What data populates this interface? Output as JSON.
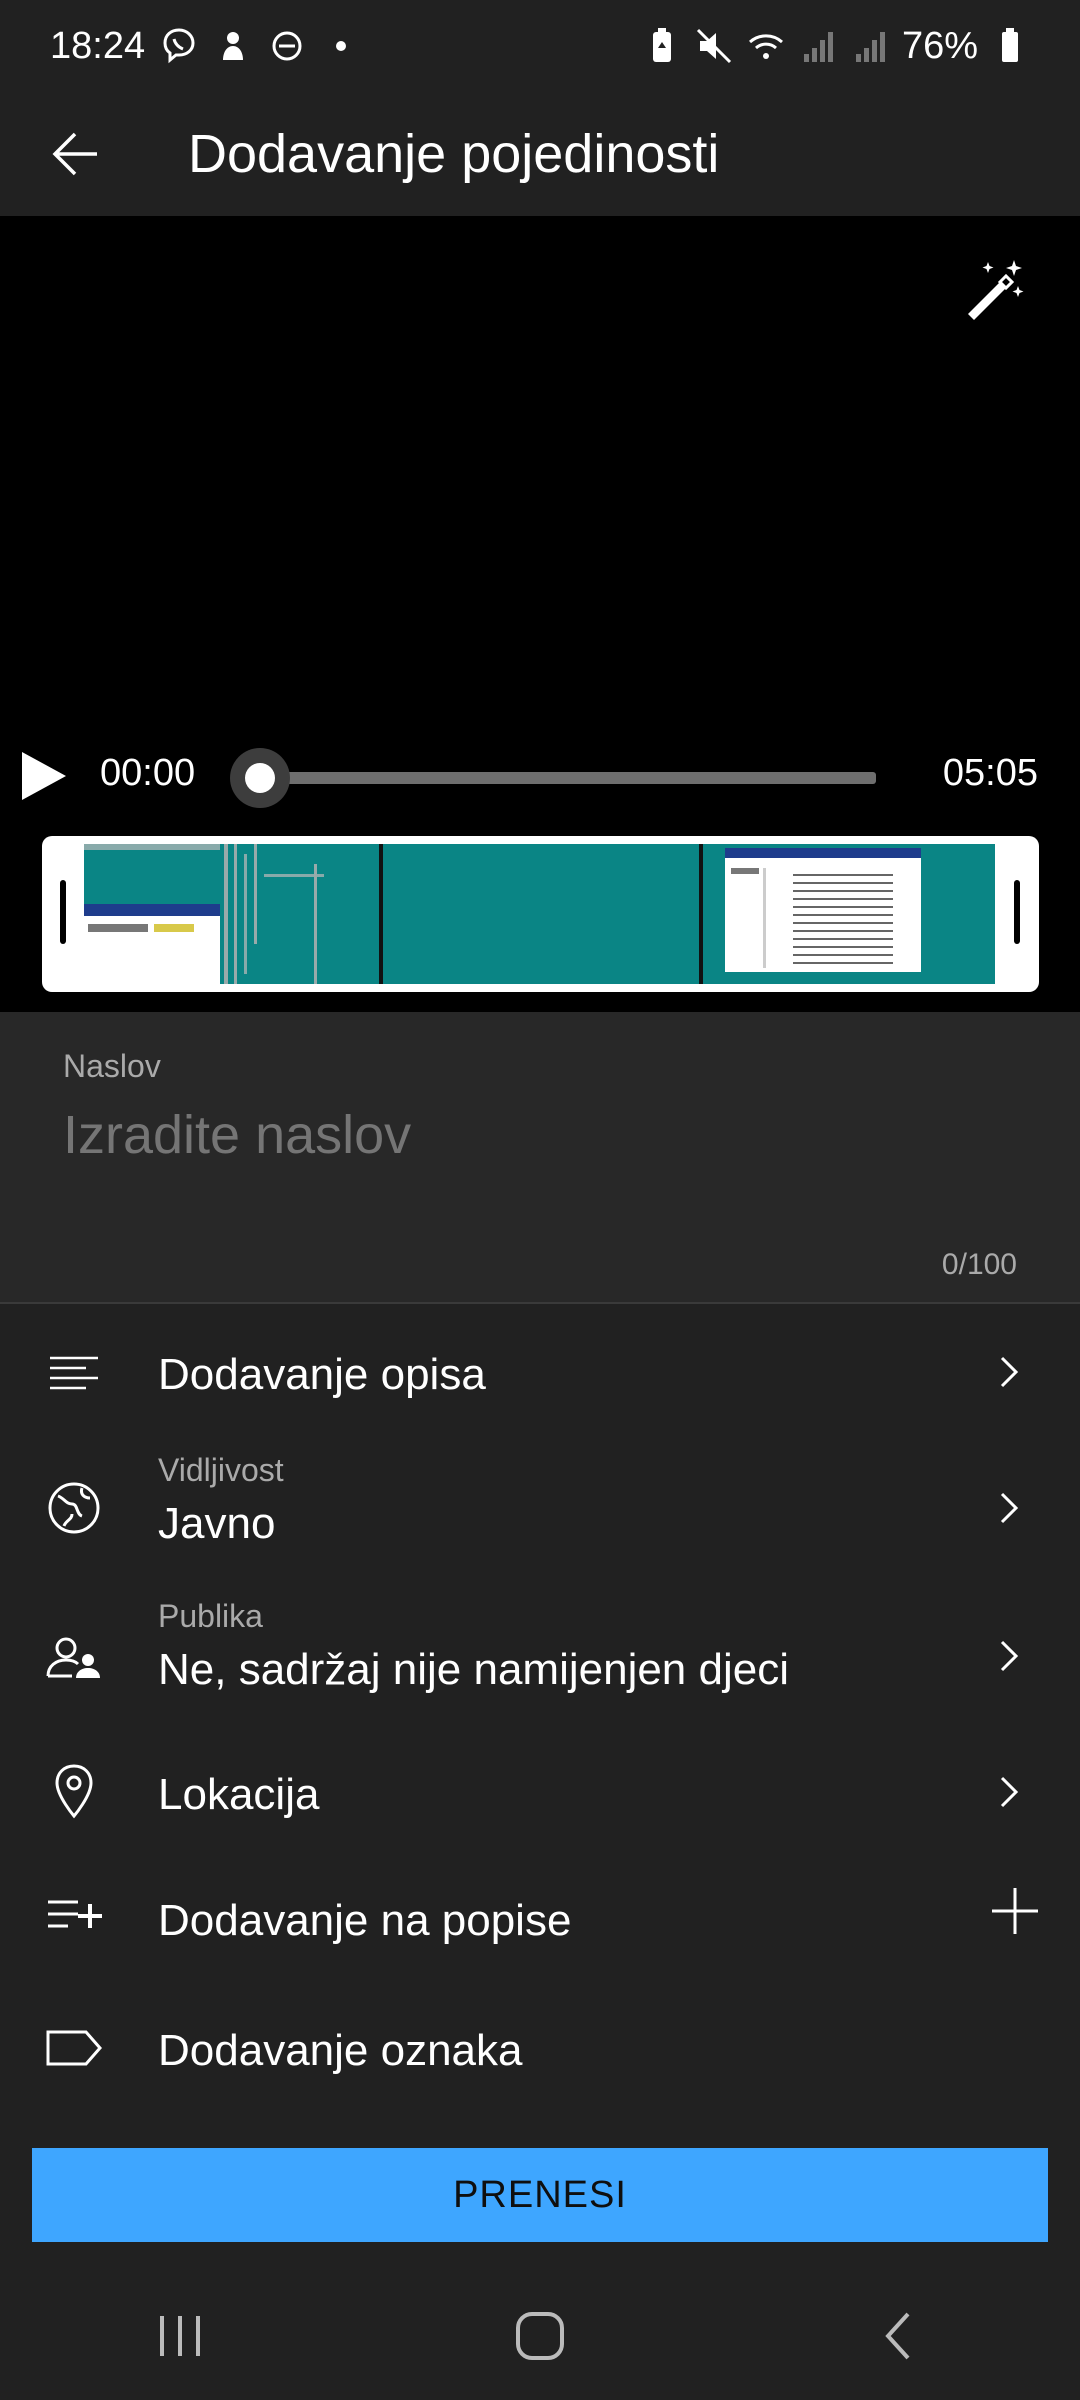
{
  "status_bar": {
    "time": "18:24",
    "battery": "76%",
    "icons": [
      "viber-icon",
      "notification-icon",
      "dnd-icon",
      "dot-icon",
      "battery-saver-icon",
      "mute-icon",
      "wifi-icon",
      "signal-icon",
      "signal-icon",
      "battery-icon"
    ]
  },
  "app_bar": {
    "title": "Dodavanje pojedinosti"
  },
  "player": {
    "current_time": "00:00",
    "total_time": "05:05",
    "progress": 0
  },
  "title_field": {
    "label": "Naslov",
    "placeholder": "Izradite naslov",
    "value": "",
    "counter": "0/100"
  },
  "menu": {
    "description": {
      "label": "Dodavanje opisa",
      "icon": "description-icon"
    },
    "visibility": {
      "sublabel": "Vidljivost",
      "label": "Javno",
      "icon": "globe-icon"
    },
    "audience": {
      "sublabel": "Publika",
      "label": "Ne, sadržaj nije namijenjen djeci",
      "icon": "audience-icon"
    },
    "location": {
      "label": "Lokacija",
      "icon": "location-pin-icon"
    },
    "playlists": {
      "label": "Dodavanje na popise",
      "icon": "playlist-add-icon"
    },
    "tags": {
      "label": "Dodavanje oznaka",
      "icon": "tag-icon"
    }
  },
  "upload_button": {
    "label": "PRENESI",
    "color": "#3ea6ff"
  },
  "colors": {
    "background": "#212121",
    "video_bg": "#000000",
    "accent": "#3ea6ff",
    "thumbnail_teal": "#008080"
  }
}
